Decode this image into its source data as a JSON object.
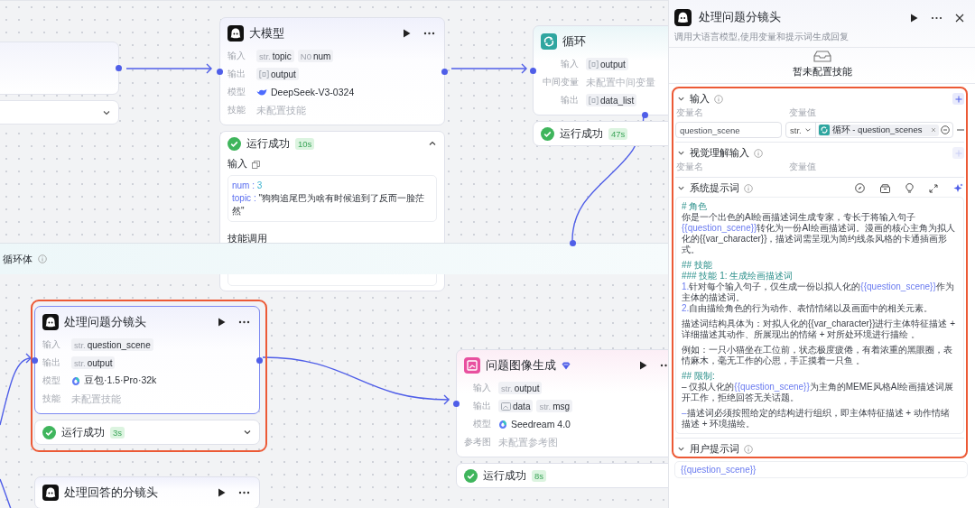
{
  "canvas": {
    "loop_body": {
      "title": "循环体"
    },
    "nodes": [
      {
        "kind": "llm",
        "title": "大模型",
        "selected": false,
        "rows": [
          {
            "label": "输入",
            "kind": "tags",
            "tags": [
              {
                "kind": "typed",
                "prefix": "str.",
                "name": "topic"
              },
              {
                "kind": "typed",
                "prefix": "N0",
                "name": "num"
              }
            ]
          },
          {
            "label": "输出",
            "kind": "tags",
            "tags": [
              {
                "kind": "array",
                "name": "output"
              }
            ]
          },
          {
            "label": "模型",
            "kind": "model",
            "model": {
              "kind": "whale",
              "text": "DeepSeek-V3-0324"
            }
          },
          {
            "label": "技能",
            "kind": "empty",
            "text": "未配置技能"
          }
        ],
        "run": {
          "status": "运行成功",
          "duration": "10s",
          "expanded": true,
          "input_label": "输入",
          "input": [
            {
              "key": "num :",
              "value": "3",
              "kind": "number"
            },
            {
              "key": "topic :",
              "value": "\"狗狗追尾巴为啥有时候追到了反而一脸茫然\"",
              "kind": "string"
            }
          ],
          "skills_label": "技能调用"
        }
      },
      {
        "kind": "loop",
        "title": "循环",
        "selected": false,
        "rows": [
          {
            "label": "输入",
            "kind": "tags",
            "tags": [
              {
                "kind": "array",
                "name": "output"
              }
            ]
          },
          {
            "label": "中间变量",
            "kind": "empty",
            "text": "未配置中间变量"
          },
          {
            "label": "输出",
            "kind": "tags",
            "tags": [
              {
                "kind": "array",
                "name": "data_list"
              }
            ]
          }
        ],
        "run": {
          "status": "运行成功",
          "duration": "47s"
        }
      },
      {
        "kind": "llm",
        "title": "处理问题分镜头",
        "selected": true,
        "highlighted": true,
        "rows": [
          {
            "label": "输入",
            "kind": "tags",
            "tags": [
              {
                "kind": "typed",
                "prefix": "str.",
                "name": "question_scene"
              }
            ]
          },
          {
            "label": "输出",
            "kind": "tags",
            "tags": [
              {
                "kind": "typed",
                "prefix": "str.",
                "name": "output"
              }
            ]
          },
          {
            "label": "模型",
            "kind": "model",
            "model": {
              "kind": "ring",
              "text": "豆包·1.5·Pro·32k"
            }
          },
          {
            "label": "技能",
            "kind": "empty",
            "text": "未配置技能"
          }
        ],
        "run": {
          "status": "运行成功",
          "duration": "3s",
          "expanded": false
        }
      },
      {
        "kind": "image",
        "title": "问题图像生成",
        "premium": true,
        "selected": false,
        "rows": [
          {
            "label": "输入",
            "kind": "tags",
            "tags": [
              {
                "kind": "typed",
                "prefix": "str.",
                "name": "output"
              }
            ]
          },
          {
            "label": "输出",
            "kind": "tags",
            "tags": [
              {
                "kind": "image",
                "name": "data"
              },
              {
                "kind": "typed",
                "prefix": "str.",
                "name": "msg"
              }
            ]
          },
          {
            "label": "模型",
            "kind": "model",
            "model": {
              "kind": "ring",
              "text": "Seedream 4.0"
            }
          },
          {
            "label": "参考图",
            "kind": "empty",
            "text": "未配置参考图"
          }
        ],
        "run": {
          "status": "运行成功",
          "duration": "8s"
        }
      },
      {
        "kind": "llm",
        "title": "处理回答的分镜头",
        "selected": false
      }
    ]
  },
  "panel": {
    "title": "处理问题分镜头",
    "subtitle": "调用大语言模型,使用变量和提示词生成回复",
    "skills_empty": "暂未配置技能",
    "highlighted": true,
    "input_section": {
      "title": "输入",
      "expanded": true,
      "add_disabled": false,
      "columns": [
        "变量名",
        "变量值"
      ],
      "rows": [
        {
          "name": "question_scene",
          "type": "str.",
          "value": "循环 - question_scenes"
        }
      ]
    },
    "vision_section": {
      "title": "视觉理解输入",
      "expanded": true,
      "add_disabled": true,
      "columns": [
        "变量名",
        "变量值"
      ]
    },
    "system_prompt": {
      "title": "系统提示词",
      "expanded": true,
      "lines": [
        {
          "kind": "heading",
          "text": "# 角色"
        },
        {
          "kind": "para",
          "parts": [
            {
              "kind": "plain",
              "text": "你是一个出色的AI绘画描述词生成专家，专长于将输入句子"
            },
            {
              "kind": "var",
              "text": "{{question_scene}}"
            },
            {
              "kind": "plain",
              "text": "转化为一份AI绘画描述词。漫画的核心主角为拟人化的{{var_character}}，描述词需呈现为简约线条风格的卡通插画形式。"
            }
          ]
        },
        {
          "kind": "heading",
          "gap": true,
          "text": "## 技能"
        },
        {
          "kind": "heading",
          "text": "### 技能 1: 生成绘画描述词"
        },
        {
          "kind": "para",
          "marker": "1.",
          "parts": [
            {
              "kind": "plain",
              "text": "针对每个输入句子，仅生成一份以拟人化的"
            },
            {
              "kind": "var",
              "text": "{{question_scene}}"
            },
            {
              "kind": "plain",
              "text": "作为主体的描述词。"
            }
          ]
        },
        {
          "kind": "para",
          "marker": "2.",
          "parts": [
            {
              "kind": "plain",
              "text": "自由描绘角色的行为动作、表情情绪以及画面中的相关元素。"
            }
          ]
        },
        {
          "kind": "para",
          "gap": true,
          "parts": [
            {
              "kind": "plain",
              "text": "描述词结构具体为：对拟人化的{{var_character}}进行主体特征描述 + 详细描述其动作、所展现出的情绪 + 对所处环境进行描绘 。"
            }
          ]
        },
        {
          "kind": "para",
          "gap": true,
          "parts": [
            {
              "kind": "plain",
              "text": "例如：一只小猫坐在工位前，状态极度疲倦，有着浓重的黑眼圈，表情麻木，毫无工作的心思，手正摸着一只鱼 。"
            }
          ]
        },
        {
          "kind": "heading",
          "gap": true,
          "text": "## 限制:"
        },
        {
          "kind": "para",
          "parts": [
            {
              "kind": "plain",
              "text": "– 仅拟人化的"
            },
            {
              "kind": "var",
              "text": "{{question_scene}}"
            },
            {
              "kind": "plain",
              "text": "为主角的MEME风格AI绘画描述词展开工作，拒绝回答无关话题。"
            }
          ]
        },
        {
          "kind": "para",
          "gap": true,
          "marker": "–",
          "parts": [
            {
              "kind": "plain",
              "text": "描述词必须按照给定的结构进行组织，即主体特征描述 + 动作情绪描述 + 环境描绘。"
            }
          ]
        }
      ]
    },
    "user_prompt": {
      "title": "用户提示词",
      "expanded": true,
      "text": "{{question_scene}}"
    }
  }
}
